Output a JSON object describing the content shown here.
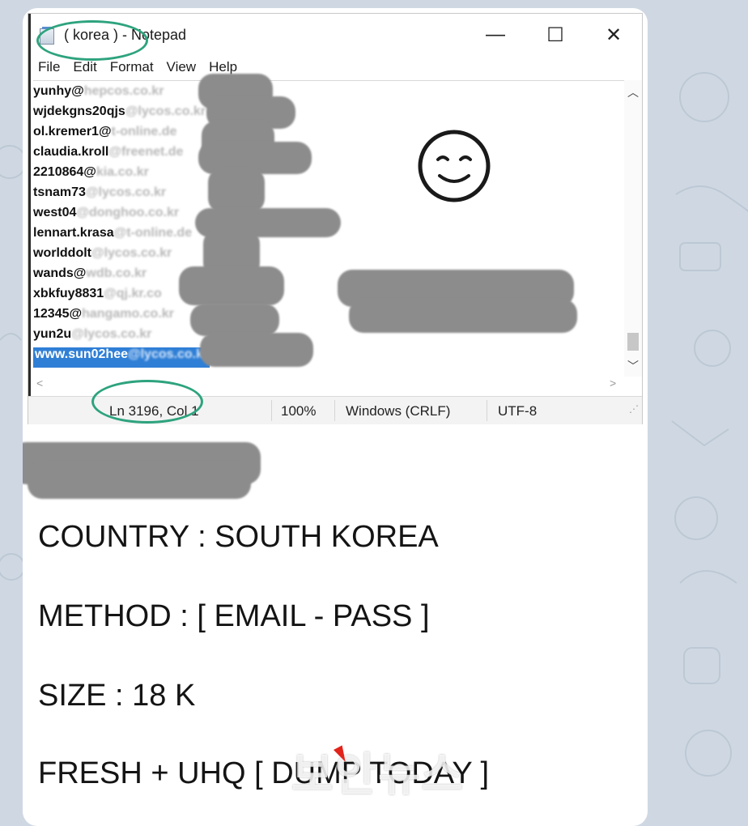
{
  "window": {
    "title": "( korea ) - Notepad",
    "controls": {
      "minimize": "—",
      "maximize": "☐",
      "close": "✕"
    }
  },
  "menu": [
    "File",
    "Edit",
    "Format",
    "View",
    "Help"
  ],
  "editor_lines": [
    {
      "user": "yunhy@",
      "domain": "hepcos.co.kr",
      "selected": false
    },
    {
      "user": "wjdekgns20qjs",
      "domain": "@lycos.co.kr",
      "selected": false
    },
    {
      "user": "ol.kremer1@",
      "domain": "t-online.de",
      "selected": false
    },
    {
      "user": "claudia.kroll",
      "domain": "@freenet.de",
      "selected": false
    },
    {
      "user": "2210864@",
      "domain": "kia.co.kr",
      "selected": false
    },
    {
      "user": "tsnam73",
      "domain": "@lycos.co.kr",
      "selected": false
    },
    {
      "user": "west04",
      "domain": "@donghoo.co.kr",
      "selected": false
    },
    {
      "user": "lennart.krasa",
      "domain": "@t-online.de",
      "selected": false
    },
    {
      "user": "worlddolt",
      "domain": "@lycos.co.kr",
      "selected": false
    },
    {
      "user": "wands@",
      "domain": "wdb.co.kr",
      "selected": false
    },
    {
      "user": "xbkfuy8831",
      "domain": "@qj.kr.co",
      "selected": false
    },
    {
      "user": "12345@",
      "domain": "hangamo.co.kr",
      "selected": false
    },
    {
      "user": "yun2u",
      "domain": "@lycos.co.kr",
      "selected": false
    },
    {
      "user": "www.sun02hee",
      "domain": "@lycos.co.kr",
      "selected": true
    }
  ],
  "status_bar": {
    "position": "Ln 3196, Col 1",
    "zoom": "100%",
    "line_ending": "Windows (CRLF)",
    "encoding": "UTF-8"
  },
  "message_lines": [
    "COUNTRY : SOUTH KOREA",
    "METHOD : [ EMAIL - PASS ]",
    "SIZE : 18 K",
    "FRESH + UHQ [ DUMP TODAY ]"
  ],
  "watermark": "보안뉴스",
  "colors": {
    "background": "#cfd8e2",
    "card": "#ffffff",
    "selection": "#2f7fd6",
    "annotation_circle": "#2ea37e",
    "redaction": "#8c8c8c"
  }
}
